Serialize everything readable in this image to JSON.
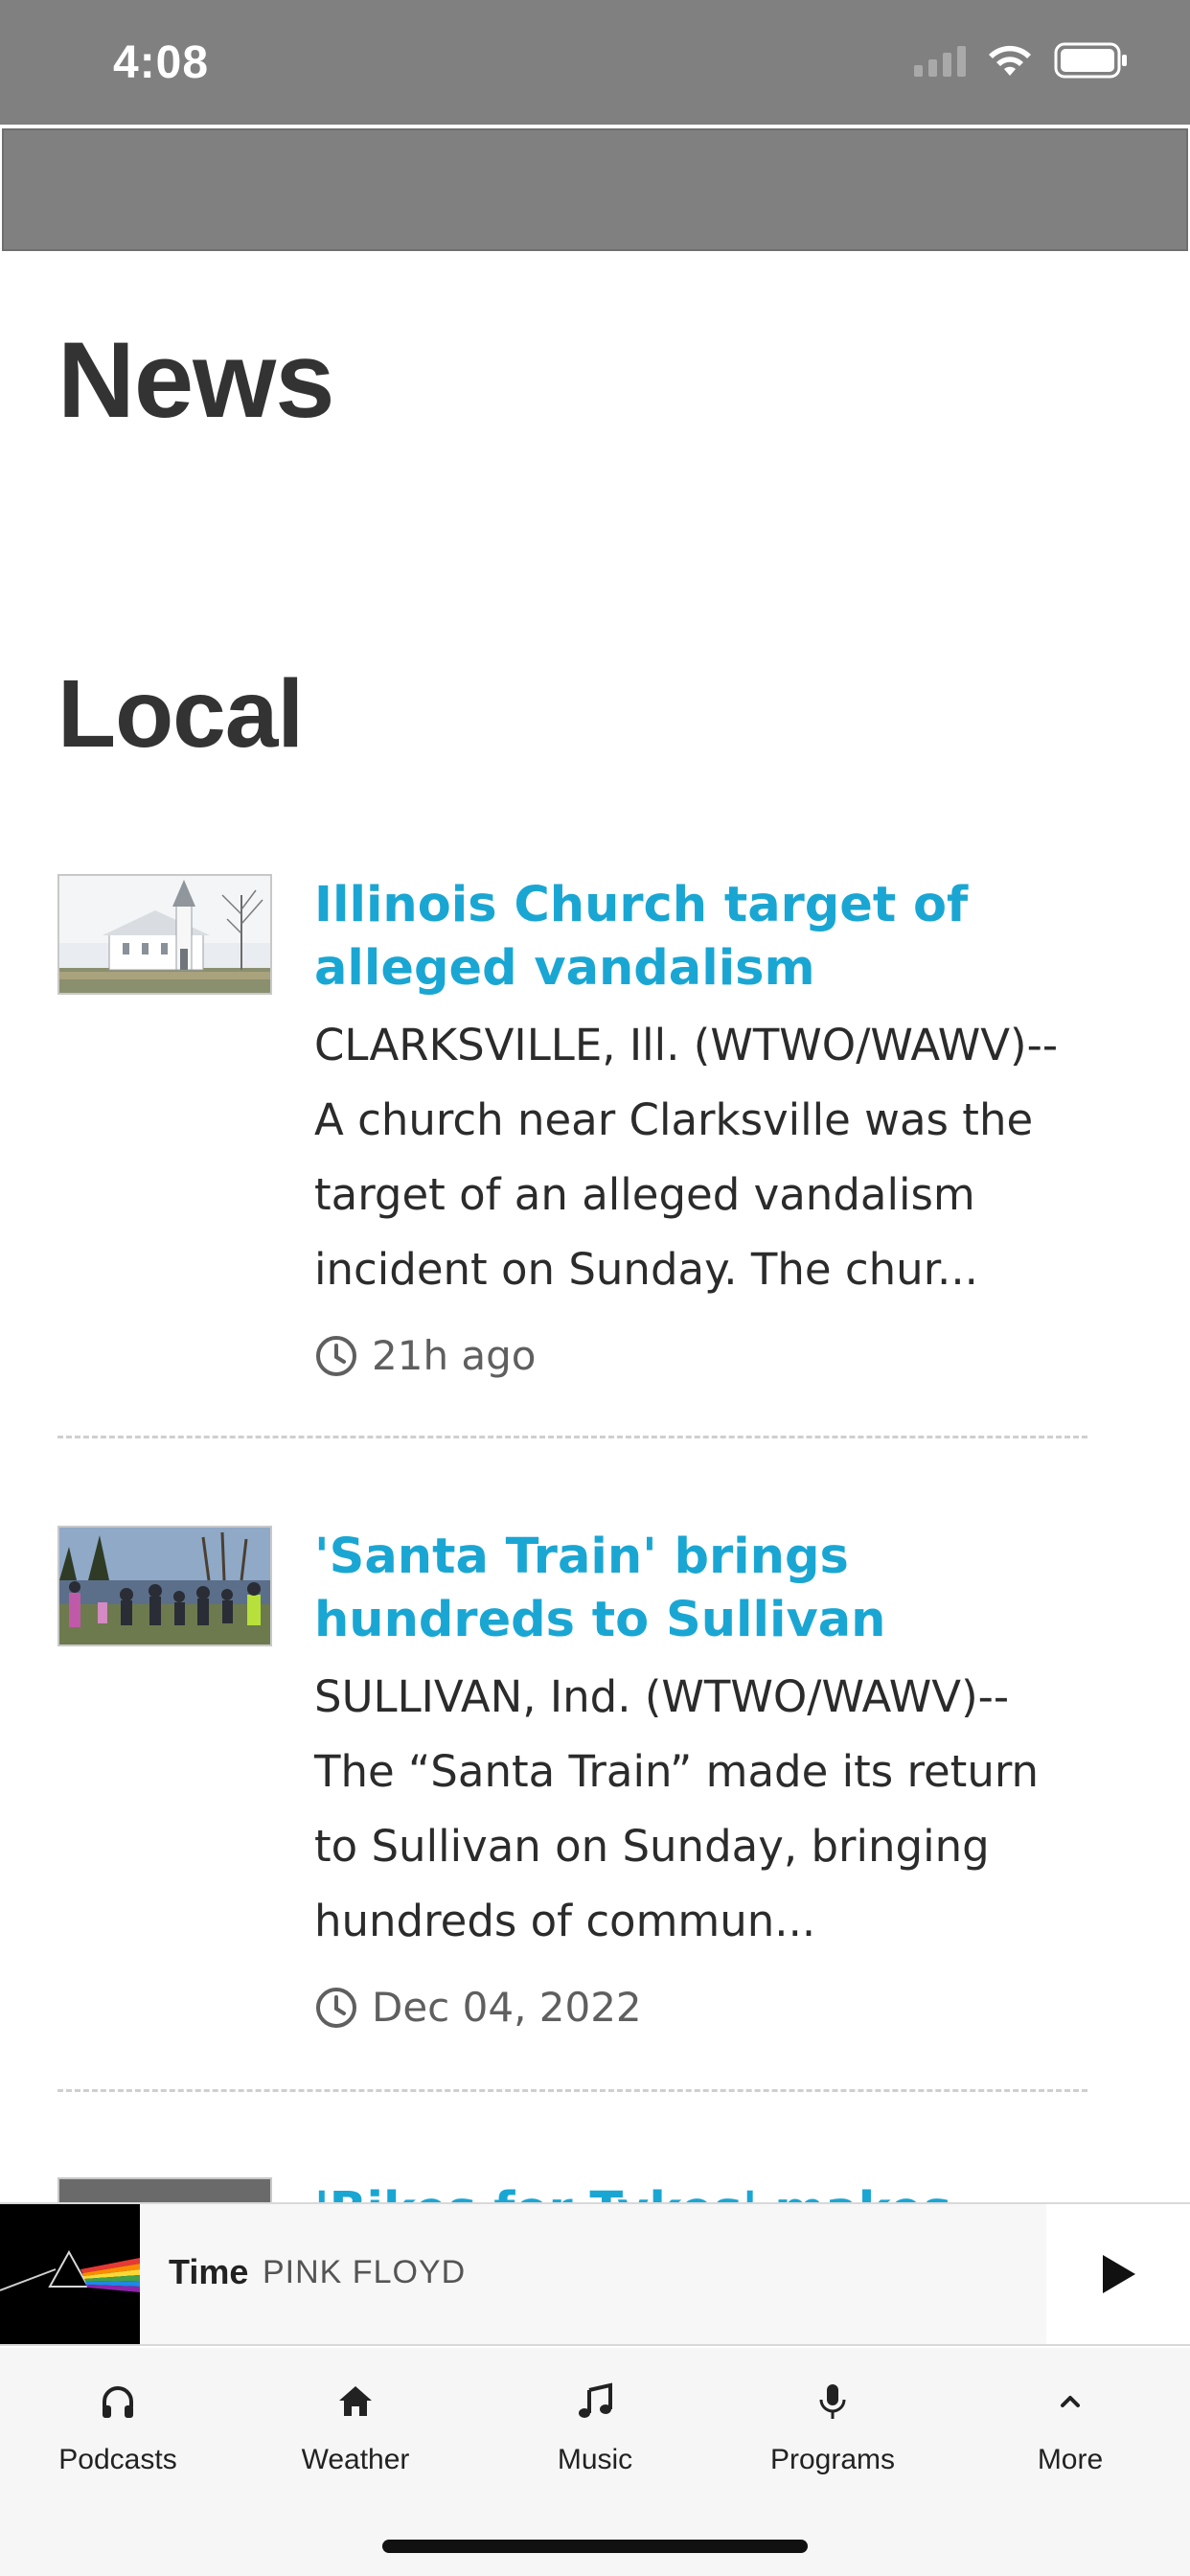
{
  "status_bar": {
    "time": "4:08"
  },
  "page": {
    "title": "News",
    "section": "Local"
  },
  "articles": [
    {
      "headline": "Illinois Church target of alleged vandalism",
      "summary": "CLARKSVILLE, Ill. (WTWO/WAWV)-- A church near Clarksville was the target of an alleged vandalism incident on Sunday. The chur...",
      "time": "21h ago"
    },
    {
      "headline": "'Santa Train' brings hundreds to Sullivan",
      "summary": "SULLIVAN, Ind. (WTWO/WAWV)-- The “Santa Train” made its return to Sullivan on Sunday, bringing hundreds of commun...",
      "time": "Dec 04, 2022"
    },
    {
      "headline": "'Bikes for Tykes' makes"
    }
  ],
  "player": {
    "title": "Time",
    "artist": "PINK FLOYD"
  },
  "nav": [
    {
      "label": "Podcasts",
      "icon": "headphones-icon"
    },
    {
      "label": "Weather",
      "icon": "home-icon"
    },
    {
      "label": "Music",
      "icon": "music-note-icon"
    },
    {
      "label": "Programs",
      "icon": "microphone-icon"
    },
    {
      "label": "More",
      "icon": "chevron-up-icon"
    }
  ],
  "colors": {
    "accent": "#1aa6d3",
    "header_gray": "#808080",
    "text": "#2b2b2b"
  }
}
